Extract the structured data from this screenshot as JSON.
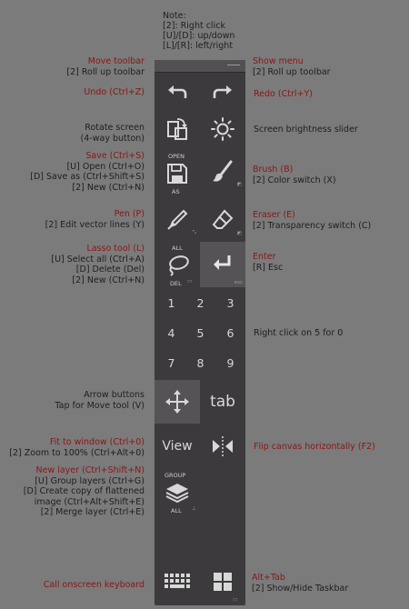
{
  "note": {
    "title": "Note:",
    "lines": [
      "[2]: Right click",
      "[U]/[D]: up/down",
      "[L]/[R]: left/right"
    ]
  },
  "left": {
    "move_toolbar": {
      "title": "Move toolbar",
      "lines": [
        "[2] Roll up toolbar"
      ]
    },
    "undo": {
      "title": "Undo (Ctrl+Z)"
    },
    "rotate": {
      "lines": [
        "Rotate screen",
        "(4-way button)"
      ]
    },
    "save": {
      "title": "Save (Ctrl+S)",
      "lines": [
        "[U] Open (Ctrl+O)",
        "[D] Save as (Ctrl+Shift+S)",
        "[2] New (Ctrl+N)"
      ]
    },
    "pen": {
      "title": "Pen (P)",
      "lines": [
        "[2] Edit vector lines (Y)"
      ]
    },
    "lasso": {
      "title": "Lasso tool (L)",
      "lines": [
        "[U] Select all (Ctrl+A)",
        "[D] Delete (Del)",
        "[2] New (Ctrl+N)"
      ]
    },
    "arrows": {
      "lines": [
        "Arrow buttons",
        "Tap for Move tool (V)"
      ]
    },
    "fit": {
      "title": "Fit to window (Ctrl+0)",
      "lines": [
        "[2] Zoom to 100% (Ctrl+Alt+0)"
      ]
    },
    "new_layer": {
      "title": "New layer (Ctrl+Shift+N)",
      "lines": [
        "[U] Group layers (Ctrl+G)",
        "[D] Create copy of flattened",
        "image (Ctrl+Alt+Shift+E)",
        "[2] Merge layer (Ctrl+E)"
      ]
    },
    "keyboard": {
      "title": "Call onscreen keyboard"
    }
  },
  "right": {
    "show_menu": {
      "title": "Show menu",
      "lines": [
        "[2] Roll up toolbar"
      ]
    },
    "redo": {
      "title": "Redo (Ctrl+Y)"
    },
    "brightness": {
      "lines": [
        "Screen brightness slider"
      ]
    },
    "brush": {
      "title": "Brush (B)",
      "lines": [
        "[2] Color switch (X)"
      ]
    },
    "eraser": {
      "title": "Eraser (E)",
      "lines": [
        "[2] Transparency switch (C)"
      ]
    },
    "enter": {
      "title": "Enter",
      "lines": [
        "[R] Esc"
      ]
    },
    "right_click": {
      "lines": [
        "Right click on 5 for 0"
      ]
    },
    "flip": {
      "title": "Flip canvas horizontally (F2)"
    },
    "alt_tab": {
      "title": "Alt+Tab",
      "lines": [
        "[2] Show/Hide Taskbar"
      ]
    }
  },
  "toolbar": {
    "small_labels": {
      "open": "OPEN",
      "as": "AS",
      "all": "ALL",
      "del": "DEL",
      "group": "GROUP",
      "all2": "ALL"
    },
    "numbers": [
      "1",
      "2",
      "3",
      "4",
      "5",
      "6",
      "7",
      "8",
      "9"
    ],
    "tab_label": "tab",
    "view_label": "View",
    "icons": [
      "undo-icon",
      "redo-icon",
      "rotate-screen-icon",
      "brightness-icon",
      "save-icon",
      "brush-icon",
      "pen-icon",
      "eraser-icon",
      "lasso-icon",
      "enter-icon",
      "move-arrows-icon",
      "flip-icon",
      "layers-icon",
      "keyboard-icon",
      "windows-icon"
    ]
  },
  "colors": {
    "background": "#7b7b7b",
    "toolbar": "#3c3a3c",
    "accent_text": "#8a1616",
    "icon": "#d8d8d8"
  }
}
